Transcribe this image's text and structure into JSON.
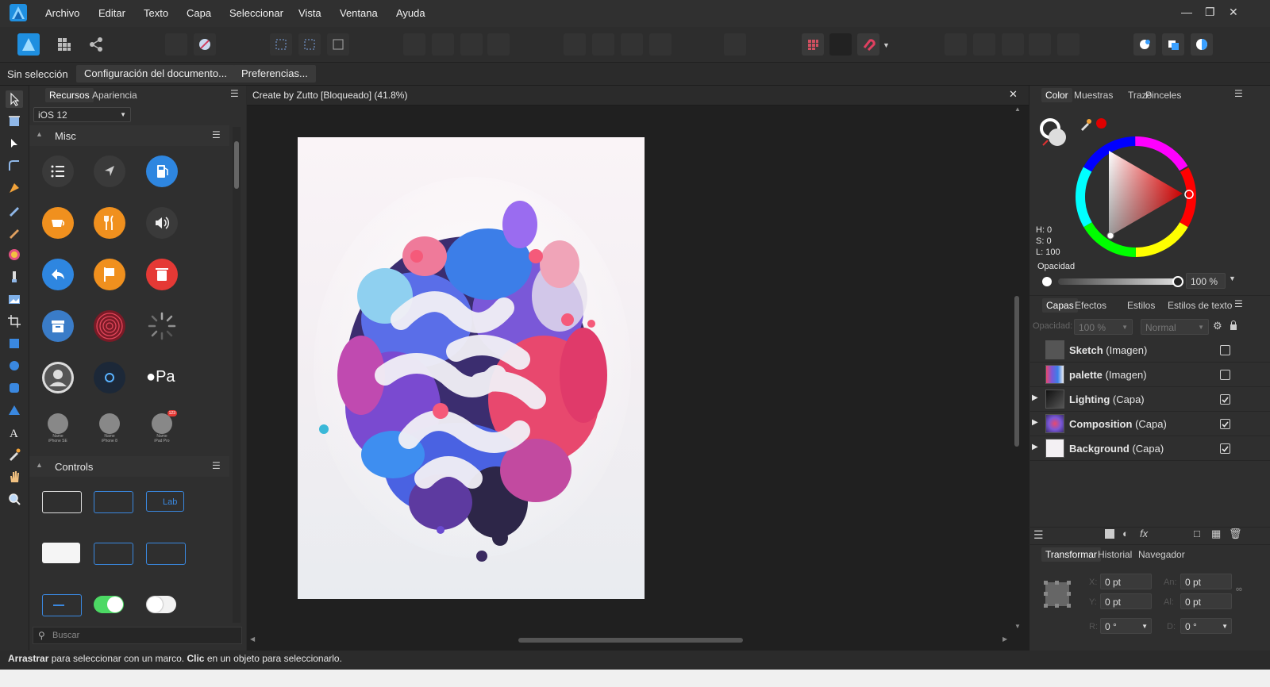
{
  "menubar": {
    "items": [
      "Archivo",
      "Editar",
      "Texto",
      "Capa",
      "Seleccionar",
      "Vista",
      "Ventana",
      "Ayuda"
    ],
    "accent": "#2aa7ff"
  },
  "context": {
    "selection_label": "Sin selección",
    "doc_setup_button": "Configuración del documento...",
    "prefs_button": "Preferencias..."
  },
  "left_panel": {
    "tabs": [
      "Recursos",
      "Apariencia"
    ],
    "category": "iOS 12",
    "misc_title": "Misc",
    "controls_title": "Controls",
    "device_labels": [
      [
        "Name",
        "iPhone SE"
      ],
      [
        "Name",
        "iPhone 8"
      ],
      [
        "Name",
        "iPad Pro"
      ]
    ],
    "badge": "123",
    "apple_pay": "Pa",
    "label_control": "Lab",
    "search_placeholder": "Buscar"
  },
  "document": {
    "tab_title": "Create by Zutto [Bloqueado] (41.8%)"
  },
  "color_panel": {
    "tabs": [
      "Color",
      "Muestras",
      "Trazo",
      "Pinceles"
    ],
    "h_label": "H: 0",
    "s_label": "S: 0",
    "l_label": "L: 100",
    "opacity_label": "Opacidad",
    "opacity_value": "100 %",
    "opacity_level": 1.0
  },
  "layers_panel": {
    "tabs": [
      "Capas",
      "Efectos",
      "Estilos",
      "Estilos de texto"
    ],
    "opacity_label": "Opacidad:",
    "opacity_value": "100 %",
    "blend_mode": "Normal",
    "layers": [
      {
        "name": "Sketch",
        "type": "(Imagen)",
        "checked": false,
        "expandable": false
      },
      {
        "name": "palette",
        "type": "(Imagen)",
        "checked": false,
        "expandable": false
      },
      {
        "name": "Lighting",
        "type": "(Capa)",
        "checked": true,
        "expandable": true
      },
      {
        "name": "Composition",
        "type": "(Capa)",
        "checked": true,
        "expandable": true
      },
      {
        "name": "Background",
        "type": "(Capa)",
        "checked": true,
        "expandable": true
      }
    ]
  },
  "transform_panel": {
    "tabs": [
      "Transformar",
      "Historial",
      "Navegador"
    ],
    "x_label": "X:",
    "x_value": "0 pt",
    "y_label": "Y:",
    "y_value": "0 pt",
    "w_label": "An:",
    "w_value": "0 pt",
    "h_label": "Al:",
    "h_value": "0 pt",
    "r_label": "R:",
    "r_value": "0 °",
    "s_label": "D:",
    "s_value": "0 °"
  },
  "status": {
    "drag_bold": "Arrastrar",
    "drag_text": " para seleccionar con un marco. ",
    "click_bold": "Clic",
    "click_text": " en un objeto para seleccionarlo."
  }
}
